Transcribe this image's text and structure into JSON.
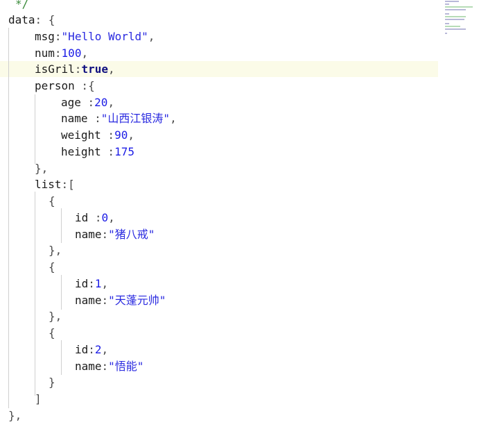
{
  "editor": {
    "lines": [
      {
        "tokens": [
          {
            "t": "*/",
            "c": "comment"
          }
        ]
      },
      {
        "tokens": [
          {
            "t": "data",
            "c": "key"
          },
          {
            "t": ": {",
            "c": "punct"
          }
        ]
      },
      {
        "tokens": [
          {
            "t": "msg",
            "c": "key"
          },
          {
            "t": ":",
            "c": "punct"
          },
          {
            "t": "\"Hello World\"",
            "c": "str"
          },
          {
            "t": ",",
            "c": "punct"
          }
        ]
      },
      {
        "tokens": [
          {
            "t": "num",
            "c": "key"
          },
          {
            "t": ":",
            "c": "punct"
          },
          {
            "t": "100",
            "c": "num"
          },
          {
            "t": ",",
            "c": "punct"
          }
        ]
      },
      {
        "tokens": [
          {
            "t": "isGril",
            "c": "key"
          },
          {
            "t": ":",
            "c": "punct"
          },
          {
            "t": "true",
            "c": "bool"
          },
          {
            "t": ",",
            "c": "punct"
          }
        ]
      },
      {
        "tokens": [
          {
            "t": "person",
            "c": "key"
          },
          {
            "t": " :{",
            "c": "punct"
          }
        ]
      },
      {
        "tokens": [
          {
            "t": "age",
            "c": "key"
          },
          {
            "t": " :",
            "c": "punct"
          },
          {
            "t": "20",
            "c": "num"
          },
          {
            "t": ",",
            "c": "punct"
          }
        ]
      },
      {
        "tokens": [
          {
            "t": "name",
            "c": "key"
          },
          {
            "t": " :",
            "c": "punct"
          },
          {
            "t": "\"山西江银涛\"",
            "c": "str"
          },
          {
            "t": ",",
            "c": "punct"
          }
        ]
      },
      {
        "tokens": [
          {
            "t": "weight",
            "c": "key"
          },
          {
            "t": " :",
            "c": "punct"
          },
          {
            "t": "90",
            "c": "num"
          },
          {
            "t": ",",
            "c": "punct"
          }
        ]
      },
      {
        "tokens": [
          {
            "t": "height",
            "c": "key"
          },
          {
            "t": " :",
            "c": "punct"
          },
          {
            "t": "175",
            "c": "num"
          }
        ]
      },
      {
        "tokens": [
          {
            "t": "},",
            "c": "punct"
          }
        ]
      },
      {
        "tokens": [
          {
            "t": "list",
            "c": "key"
          },
          {
            "t": ":[",
            "c": "punct"
          }
        ]
      },
      {
        "tokens": [
          {
            "t": "{",
            "c": "punct"
          }
        ]
      },
      {
        "tokens": [
          {
            "t": "id",
            "c": "key"
          },
          {
            "t": " :",
            "c": "punct"
          },
          {
            "t": "0",
            "c": "num"
          },
          {
            "t": ",",
            "c": "punct"
          }
        ]
      },
      {
        "tokens": [
          {
            "t": "name",
            "c": "key"
          },
          {
            "t": ":",
            "c": "punct"
          },
          {
            "t": "\"猪八戒\"",
            "c": "str"
          }
        ]
      },
      {
        "tokens": [
          {
            "t": "},",
            "c": "punct"
          }
        ]
      },
      {
        "tokens": [
          {
            "t": "{",
            "c": "punct"
          }
        ]
      },
      {
        "tokens": [
          {
            "t": "id",
            "c": "key"
          },
          {
            "t": ":",
            "c": "punct"
          },
          {
            "t": "1",
            "c": "num"
          },
          {
            "t": ",",
            "c": "punct"
          }
        ]
      },
      {
        "tokens": [
          {
            "t": "name",
            "c": "key"
          },
          {
            "t": ":",
            "c": "punct"
          },
          {
            "t": "\"天蓬元帅\"",
            "c": "str"
          }
        ]
      },
      {
        "tokens": [
          {
            "t": "},",
            "c": "punct"
          }
        ]
      },
      {
        "tokens": [
          {
            "t": "{",
            "c": "punct"
          }
        ]
      },
      {
        "tokens": [
          {
            "t": "id",
            "c": "key"
          },
          {
            "t": ":",
            "c": "punct"
          },
          {
            "t": "2",
            "c": "num"
          },
          {
            "t": ",",
            "c": "punct"
          }
        ]
      },
      {
        "tokens": [
          {
            "t": "name",
            "c": "key"
          },
          {
            "t": ":",
            "c": "punct"
          },
          {
            "t": "\"悟能\"",
            "c": "str"
          }
        ]
      },
      {
        "tokens": [
          {
            "t": "}",
            "c": "punct"
          }
        ]
      },
      {
        "tokens": [
          {
            "t": "]",
            "c": "punct"
          }
        ]
      },
      {
        "tokens": [
          {
            "t": "},",
            "c": "punct"
          }
        ]
      }
    ]
  },
  "colors": {
    "keyword": "#1b1b1b",
    "number": "#1c1ce6",
    "string": "#2a2ae0",
    "boolean": "#101080",
    "comment": "#3a8a3a",
    "current_line": "#fbfbe8"
  }
}
